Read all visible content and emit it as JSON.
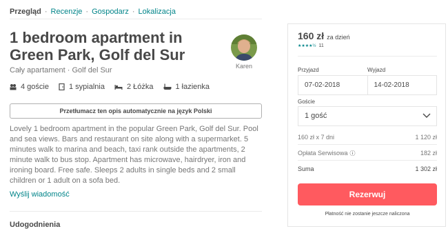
{
  "nav": {
    "items": [
      "Przegląd",
      "Recenzje",
      "Gospodarz",
      "Lokalizacja"
    ],
    "separator": "·"
  },
  "listing": {
    "title": "1 bedroom apartment in Green Park, Golf del Sur",
    "subtitle": "Cały apartament · Golf del Sur",
    "host_name": "Karen",
    "amenities": {
      "guests": "4 goście",
      "bedrooms": "1 sypialnia",
      "beds": "2 Łóżka",
      "baths": "1 łazienka"
    },
    "translate_button": "Przetłumacz ten opis automatycznie na język Polski",
    "description": "Lovely 1 bedroom apartment in the popular Green Park, Golf del Sur. Pool and sea views. Bars and restaurant on site along with a supermarket. 5 minutes walk to marina and beach, taxi rank outside the apartments, 2 minute walk to bus stop. Apartment has microwave, hairdryer, iron and ironing board. Free safe. Sleeps 2 adults in single beds and 2 small children or 1 adult on a sofa bed.",
    "message_link": "Wyślij wiadomość",
    "section_heading": "Udogodnienia"
  },
  "booking": {
    "price": "160 zł",
    "per": "za dzień",
    "stars": "★★★★½",
    "review_count": "11",
    "checkin_label": "Przyjazd",
    "checkout_label": "Wyjazd",
    "checkin": "07-02-2018",
    "checkout": "14-02-2018",
    "guests_label": "Goście",
    "guests_value": "1 gość",
    "lines": [
      {
        "label": "160 zł x 7 dni",
        "value": "1 120 zł"
      },
      {
        "label": "Opłata Serwisowa",
        "value": "182 zł"
      }
    ],
    "total_label": "Suma",
    "total_value": "1 302 zł",
    "info_icon": "ⓘ",
    "book_button": "Rezerwuj",
    "note": "Płatność nie zostanie jeszcze naliczona"
  },
  "colors": {
    "accent": "#008489",
    "brand": "#ff5a5f",
    "text": "#484848",
    "muted": "#767676"
  },
  "icons": {
    "guests": "guests-icon",
    "bedroom": "door-icon",
    "beds": "bed-icon",
    "bath": "bathtub-icon",
    "dropdown": "chevron-down-icon"
  }
}
